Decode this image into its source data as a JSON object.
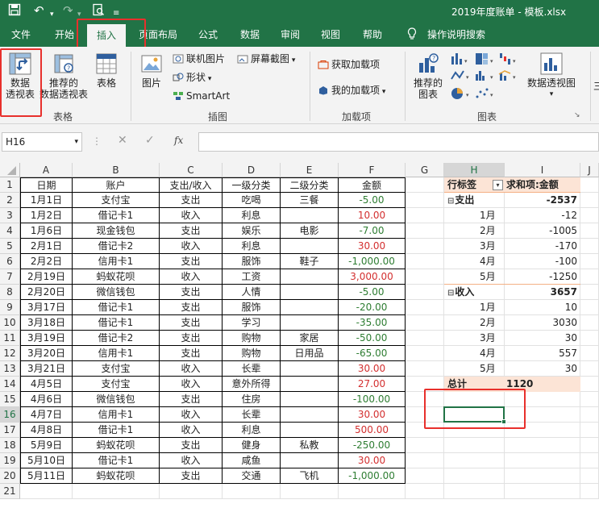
{
  "title": "2019年度账单 - 模板.xlsx",
  "tabs": [
    "文件",
    "开始",
    "插入",
    "页面布局",
    "公式",
    "数据",
    "审阅",
    "视图",
    "帮助"
  ],
  "search_label": "操作说明搜索",
  "ribbon": {
    "pivot_btn": [
      "数据",
      "透视表"
    ],
    "recommended_pivot_btn": [
      "推荐的",
      "数据透视表"
    ],
    "table_btn": "表格",
    "group_tables": "表格",
    "pictures_btn": "图片",
    "online_pictures": "联机图片",
    "shapes": "形状",
    "smartart": "SmartArt",
    "screenshot": "屏幕截图",
    "group_illustrations": "插图",
    "get_addins": "获取加载项",
    "my_addins": "我的加载项",
    "group_addins": "加载项",
    "recommended_charts": [
      "推荐的",
      "图表"
    ],
    "pivot_chart": "数据透视图",
    "group_charts": "图表"
  },
  "formula_bar": {
    "name_box": "H16",
    "fx": "fx",
    "value": ""
  },
  "columns": [
    "A",
    "B",
    "C",
    "D",
    "E",
    "F",
    "G",
    "H",
    "I",
    "J"
  ],
  "rows": [
    "1",
    "2",
    "3",
    "4",
    "5",
    "6",
    "7",
    "8",
    "9",
    "10",
    "11",
    "12",
    "13",
    "14",
    "15",
    "16",
    "17",
    "18",
    "19",
    "20",
    "21"
  ],
  "table": {
    "headers": [
      "日期",
      "账户",
      "支出/收入",
      "一级分类",
      "二级分类",
      "金额"
    ],
    "rows": [
      [
        "1月1日",
        "支付宝",
        "支出",
        "吃喝",
        "三餐",
        "-5.00"
      ],
      [
        "1月2日",
        "借记卡1",
        "收入",
        "利息",
        "",
        "10.00"
      ],
      [
        "1月6日",
        "现金钱包",
        "支出",
        "娱乐",
        "电影",
        "-7.00"
      ],
      [
        "2月1日",
        "借记卡2",
        "收入",
        "利息",
        "",
        "30.00"
      ],
      [
        "2月2日",
        "信用卡1",
        "支出",
        "服饰",
        "鞋子",
        "-1,000.00"
      ],
      [
        "2月19日",
        "蚂蚁花呗",
        "收入",
        "工资",
        "",
        "3,000.00"
      ],
      [
        "2月20日",
        "微信钱包",
        "支出",
        "人情",
        "",
        "-5.00"
      ],
      [
        "3月17日",
        "借记卡1",
        "支出",
        "服饰",
        "",
        "-20.00"
      ],
      [
        "3月18日",
        "借记卡1",
        "支出",
        "学习",
        "",
        "-35.00"
      ],
      [
        "3月19日",
        "借记卡2",
        "支出",
        "购物",
        "家居",
        "-50.00"
      ],
      [
        "3月20日",
        "信用卡1",
        "支出",
        "购物",
        "日用品",
        "-65.00"
      ],
      [
        "3月21日",
        "支付宝",
        "收入",
        "长辈",
        "",
        "30.00"
      ],
      [
        "4月5日",
        "支付宝",
        "收入",
        "意外所得",
        "",
        "27.00"
      ],
      [
        "4月6日",
        "微信钱包",
        "支出",
        "住房",
        "",
        "-100.00"
      ],
      [
        "4月7日",
        "信用卡1",
        "收入",
        "长辈",
        "",
        "30.00"
      ],
      [
        "4月8日",
        "借记卡1",
        "收入",
        "利息",
        "",
        "500.00"
      ],
      [
        "5月9日",
        "蚂蚁花呗",
        "支出",
        "健身",
        "私教",
        "-250.00"
      ],
      [
        "5月10日",
        "借记卡1",
        "收入",
        "咸鱼",
        "",
        "30.00"
      ],
      [
        "5月11日",
        "蚂蚁花呗",
        "支出",
        "交通",
        "飞机",
        "-1,000.00"
      ]
    ]
  },
  "pivot": {
    "header_rows": "行标签",
    "header_values": "求和项:金额",
    "rows": [
      {
        "label": "支出",
        "value": "-2537",
        "level": 0,
        "collapse": "⊟"
      },
      {
        "label": "1月",
        "value": "-12",
        "level": 1
      },
      {
        "label": "2月",
        "value": "-1005",
        "level": 1
      },
      {
        "label": "3月",
        "value": "-170",
        "level": 1
      },
      {
        "label": "4月",
        "value": "-100",
        "level": 1
      },
      {
        "label": "5月",
        "value": "-1250",
        "level": 1
      },
      {
        "label": "收入",
        "value": "3657",
        "level": 0,
        "collapse": "⊟"
      },
      {
        "label": "1月",
        "value": "10",
        "level": 1
      },
      {
        "label": "2月",
        "value": "3030",
        "level": 1
      },
      {
        "label": "3月",
        "value": "30",
        "level": 1
      },
      {
        "label": "4月",
        "value": "557",
        "level": 1
      },
      {
        "label": "5月",
        "value": "30",
        "level": 1
      }
    ],
    "total_label": "总计",
    "total_value": "1120"
  },
  "selected_cell": "H16",
  "colors": {
    "excel_green": "#217346",
    "highlight_red": "#e8302c",
    "pivot_header": "#fce4d6",
    "negative": "#2e7d32",
    "positive": "#d32f2f"
  }
}
